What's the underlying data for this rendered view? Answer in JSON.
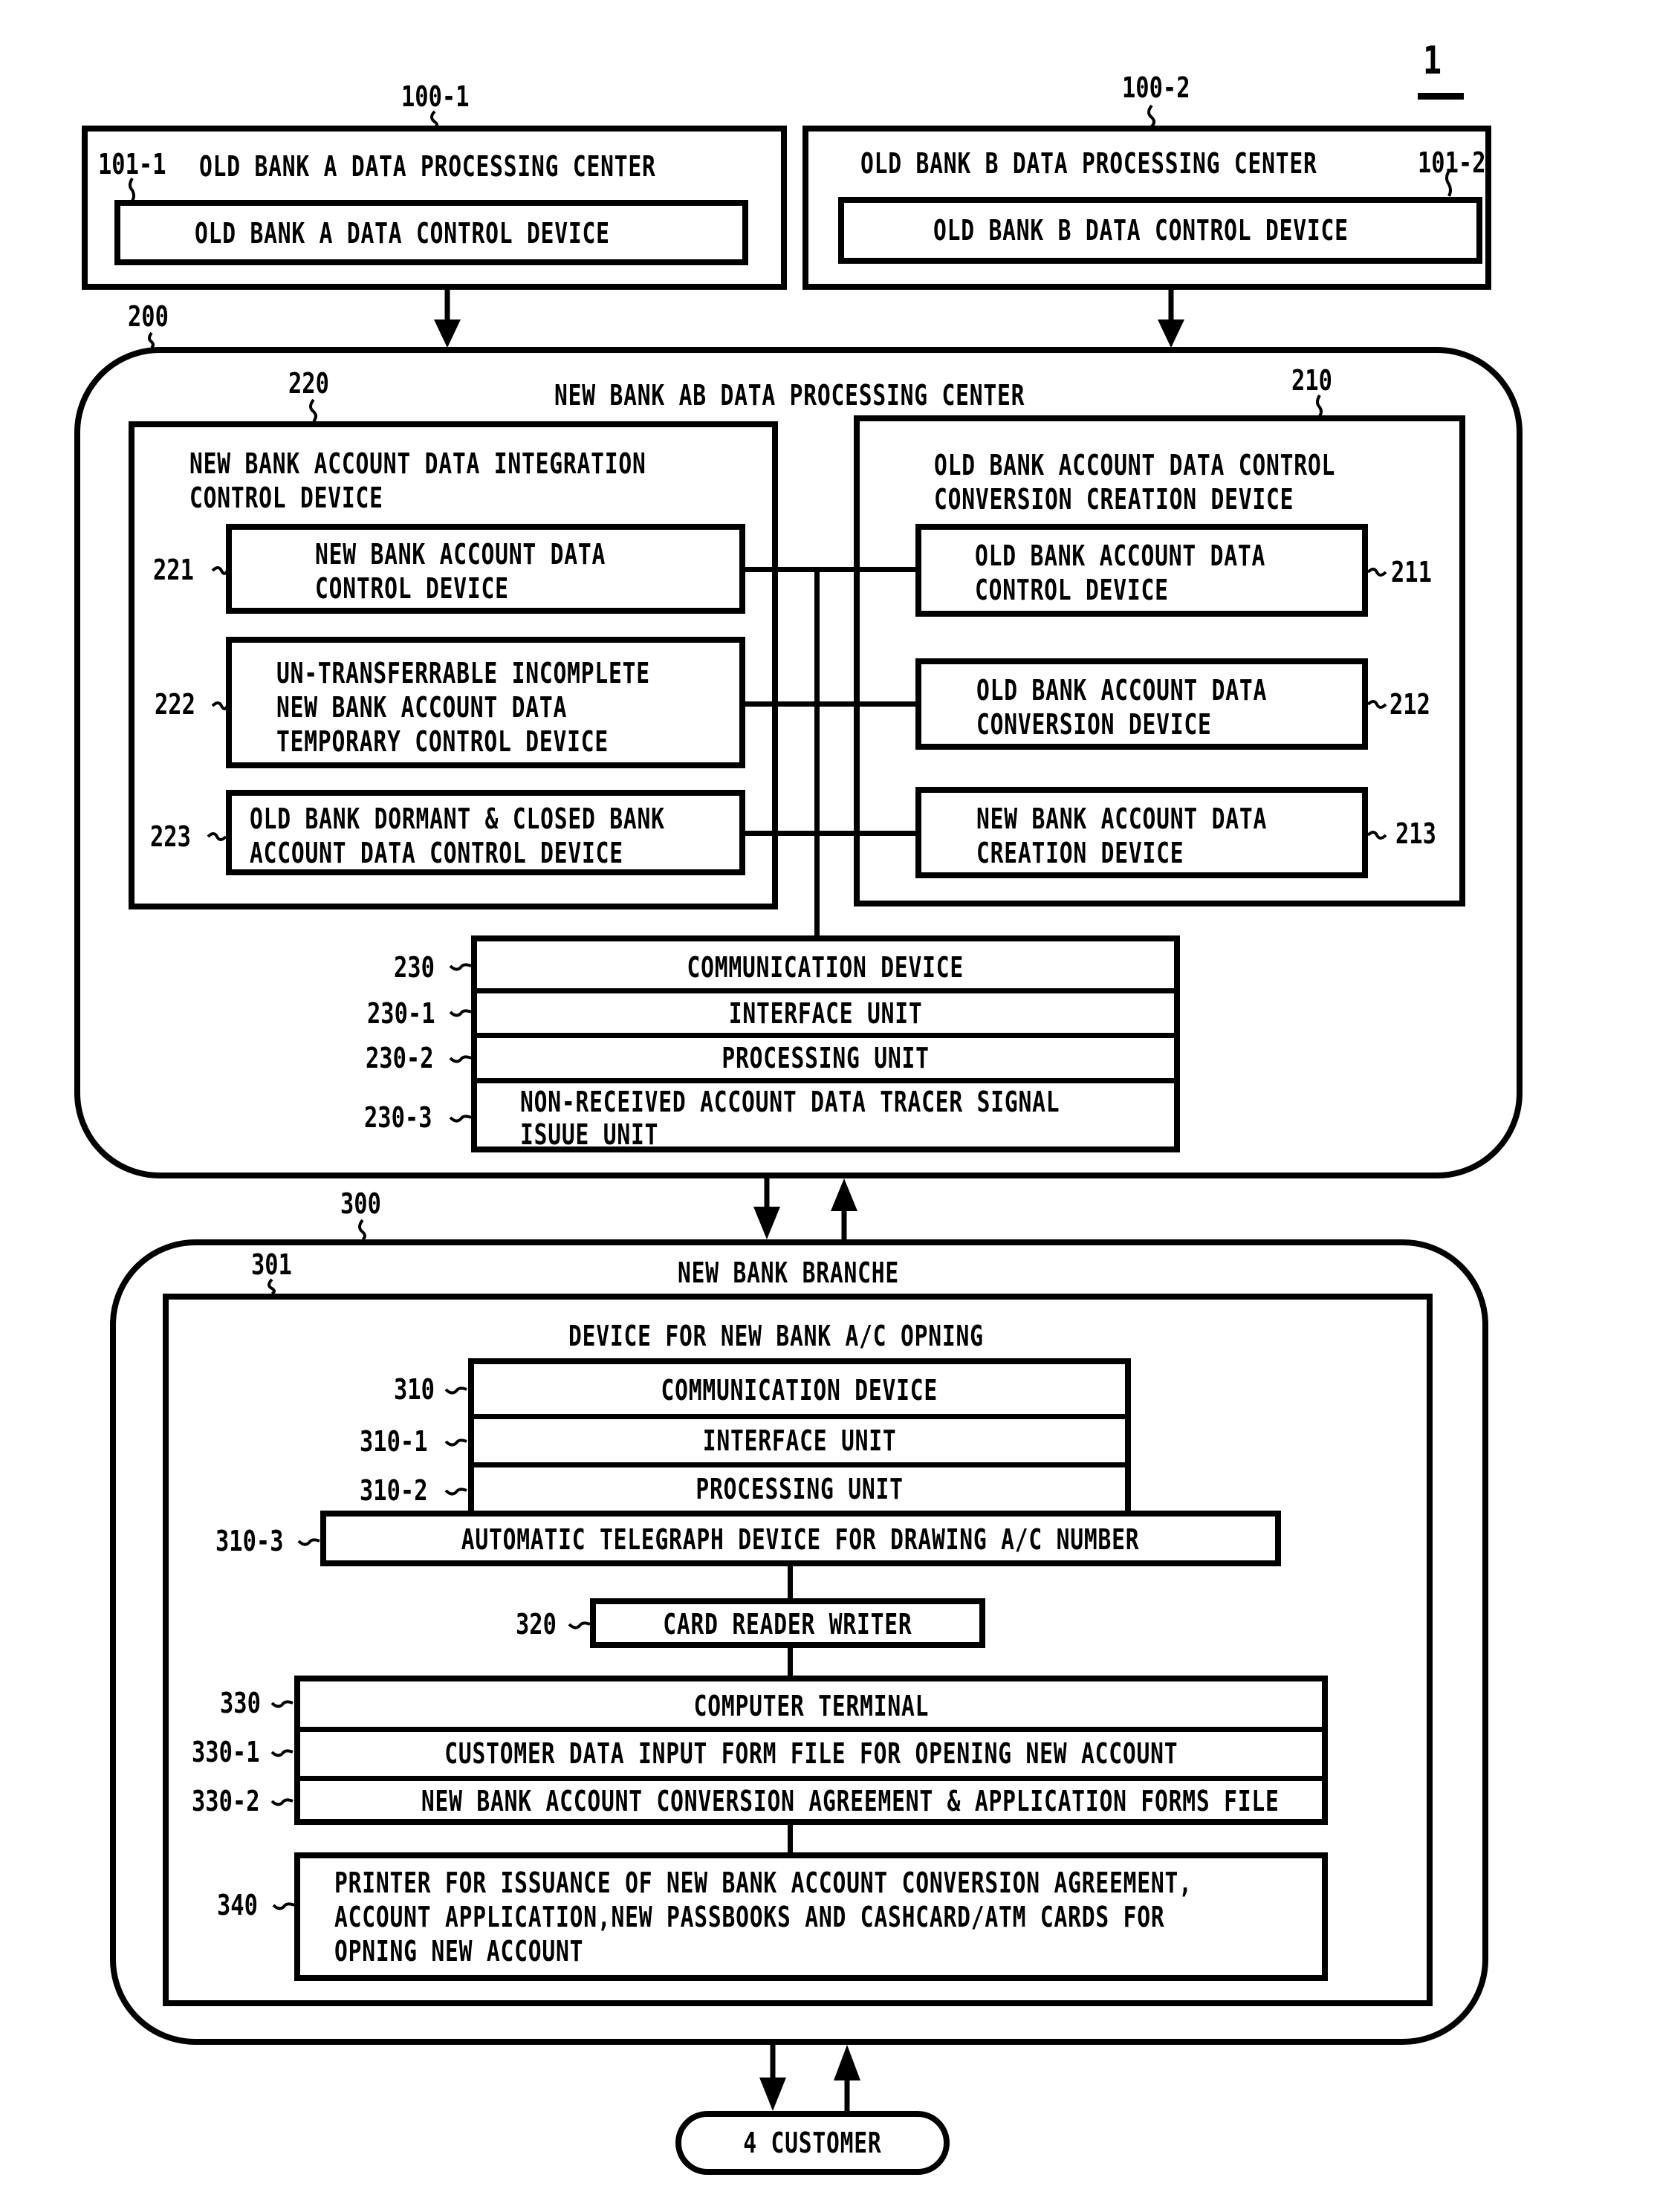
{
  "figure_number": "1",
  "old_bank_a": {
    "ref": "100-1",
    "title": "OLD BANK A DATA PROCESSING CENTER",
    "device_ref": "101-1",
    "device": "OLD BANK A DATA CONTROL DEVICE"
  },
  "old_bank_b": {
    "ref": "100-2",
    "title": "OLD BANK B DATA PROCESSING CENTER",
    "device_ref": "101-2",
    "device": "OLD BANK B DATA CONTROL DEVICE"
  },
  "new_center": {
    "ref": "200",
    "title": "NEW BANK AB DATA PROCESSING CENTER",
    "integration": {
      "ref": "220",
      "title_line1": "NEW BANK ACCOUNT DATA INTEGRATION",
      "title_line2": "CONTROL DEVICE",
      "items": [
        {
          "ref": "221",
          "line1": "NEW BANK ACCOUNT DATA",
          "line2": "CONTROL DEVICE",
          "line3": ""
        },
        {
          "ref": "222",
          "line1": "UN-TRANSFERRABLE INCOMPLETE",
          "line2": "NEW BANK ACCOUNT DATA",
          "line3": "TEMPORARY CONTROL DEVICE"
        },
        {
          "ref": "223",
          "line1": "OLD BANK DORMANT & CLOSED BANK",
          "line2": "ACCOUNT DATA CONTROL DEVICE",
          "line3": ""
        }
      ]
    },
    "conversion": {
      "ref": "210",
      "title_line1": "OLD BANK ACCOUNT DATA CONTROL",
      "title_line2": "CONVERSION CREATION DEVICE",
      "items": [
        {
          "ref": "211",
          "line1": "OLD BANK ACCOUNT DATA",
          "line2": "CONTROL DEVICE"
        },
        {
          "ref": "212",
          "line1": "OLD BANK ACCOUNT DATA",
          "line2": "CONVERSION DEVICE"
        },
        {
          "ref": "213",
          "line1": "NEW BANK ACCOUNT DATA",
          "line2": "CREATION DEVICE"
        }
      ]
    },
    "communication": {
      "rows": [
        {
          "ref": "230",
          "label": "COMMUNICATION DEVICE"
        },
        {
          "ref": "230-1",
          "label": "INTERFACE UNIT"
        },
        {
          "ref": "230-2",
          "label": "PROCESSING UNIT"
        },
        {
          "ref": "230-3",
          "label_line1": "NON-RECEIVED ACCOUNT DATA TRACER SIGNAL",
          "label_line2": "ISUUE UNIT"
        }
      ]
    }
  },
  "branch": {
    "ref": "300",
    "title": "NEW BANK BRANCHE",
    "device": {
      "ref": "301",
      "title": "DEVICE FOR NEW BANK A/C OPNING",
      "communication_rows": [
        {
          "ref": "310",
          "label": "COMMUNICATION DEVICE"
        },
        {
          "ref": "310-1",
          "label": "INTERFACE UNIT"
        },
        {
          "ref": "310-2",
          "label": "PROCESSING UNIT"
        }
      ],
      "telegraph": {
        "ref": "310-3",
        "label": "AUTOMATIC TELEGRAPH DEVICE FOR DRAWING A/C NUMBER"
      },
      "card_reader": {
        "ref": "320",
        "label": "CARD READER WRITER"
      },
      "terminal_rows": [
        {
          "ref": "330",
          "label": "COMPUTER TERMINAL"
        },
        {
          "ref": "330-1",
          "label": "CUSTOMER DATA INPUT FORM FILE FOR OPENING NEW ACCOUNT"
        },
        {
          "ref": "330-2",
          "label": "NEW BANK ACCOUNT CONVERSION AGREEMENT & APPLICATION FORMS FILE"
        }
      ],
      "printer": {
        "ref": "340",
        "line1": "PRINTER FOR ISSUANCE OF NEW BANK ACCOUNT CONVERSION AGREEMENT,",
        "line2": "ACCOUNT APPLICATION,NEW PASSBOOKS AND CASHCARD/ATM CARDS FOR",
        "line3": "OPNING NEW ACCOUNT"
      }
    }
  },
  "customer": {
    "label": "4 CUSTOMER"
  }
}
